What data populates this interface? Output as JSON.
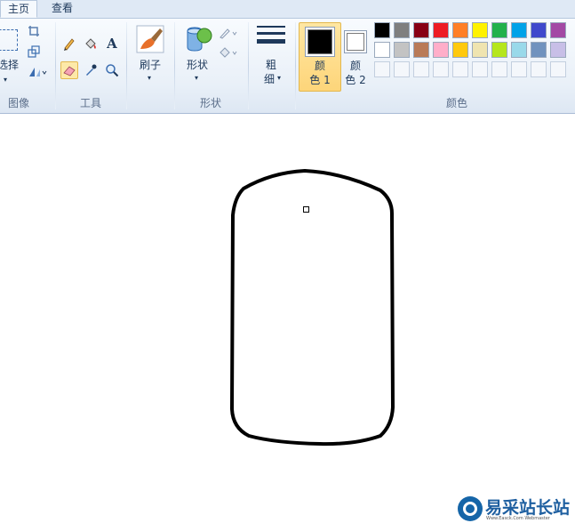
{
  "tabs": [
    {
      "label": "主页",
      "active": true
    },
    {
      "label": "查看",
      "active": false
    }
  ],
  "ribbon": {
    "image_group": {
      "select_label": "选择",
      "group_label": "图像"
    },
    "tools_group": {
      "group_label": "工具"
    },
    "brushes": {
      "label": "刷子"
    },
    "shapes_group": {
      "shapes_label": "形状",
      "group_label": "形状"
    },
    "size": {
      "label_line1": "粗",
      "label_line2": "细"
    },
    "color1": {
      "label_line1": "颜",
      "label_line2": "色 1",
      "color": "#000000"
    },
    "color2": {
      "label_line1": "颜",
      "label_line2": "色 2",
      "color": "#ffffff"
    },
    "colors_group": {
      "group_label": "颜色"
    },
    "palette_row1": [
      "#000000",
      "#7f7f7f",
      "#880015",
      "#ed1c24",
      "#ff7f27",
      "#fff200",
      "#22b14c",
      "#00a2e8",
      "#3f48cc",
      "#a349a4"
    ],
    "palette_row2": [
      "#ffffff",
      "#c3c3c3",
      "#b97a57",
      "#ffaec9",
      "#ffc90e",
      "#efe4b0",
      "#b5e61d",
      "#99d9ea",
      "#7092be",
      "#c8bfe7"
    ]
  },
  "watermark": {
    "title": "易采站长站",
    "subtitle": "Www.Easck.Com Webmaster"
  }
}
